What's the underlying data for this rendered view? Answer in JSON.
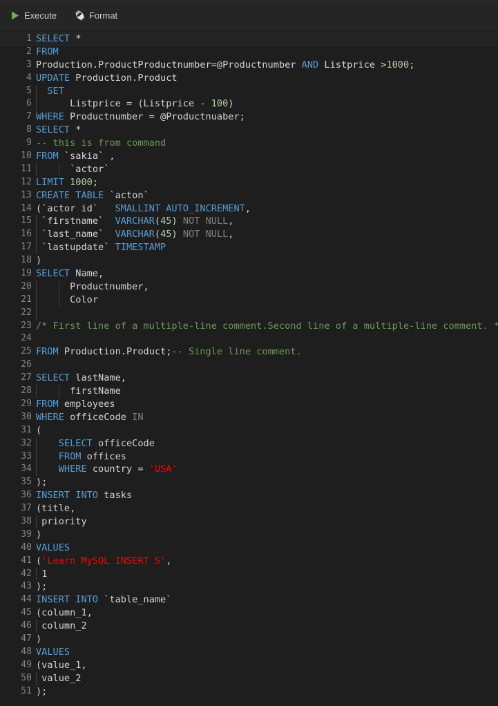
{
  "toolbar": {
    "execute": {
      "label": "Execute",
      "icon": "play-icon",
      "icon_color": "#6ab04c"
    },
    "format": {
      "label": "Format",
      "icon": "brush-icon"
    }
  },
  "editor": {
    "language": "sql",
    "theme": "dark",
    "active_line": 1,
    "total_lines": 51,
    "colors": {
      "background": "#1e1e1e",
      "gutter_text": "#858585",
      "keyword": "#569cd6",
      "plain": "#d4d4d4",
      "number": "#b5cea8",
      "string": "#ff0000",
      "comment": "#6a9955",
      "muted": "#808080",
      "indent_guide": "#404040",
      "active_line_bg": "#232323"
    },
    "lines": [
      {
        "n": "1",
        "active": true,
        "guides": [],
        "tokens": [
          {
            "t": "SELECT",
            "c": "kw"
          },
          {
            "t": " ",
            "c": "punc"
          },
          {
            "t": "*",
            "c": "txt"
          }
        ]
      },
      {
        "n": "2",
        "guides": [],
        "tokens": [
          {
            "t": "FROM",
            "c": "kw"
          }
        ]
      },
      {
        "n": "3",
        "guides": [],
        "tokens": [
          {
            "t": "Production.ProductProductnumber=@Productnumber ",
            "c": "txt"
          },
          {
            "t": "AND",
            "c": "kw"
          },
          {
            "t": " Listprice >",
            "c": "txt"
          },
          {
            "t": "1000",
            "c": "num"
          },
          {
            "t": ";",
            "c": "punc"
          }
        ]
      },
      {
        "n": "4",
        "guides": [],
        "tokens": [
          {
            "t": "UPDATE",
            "c": "kw"
          },
          {
            "t": " Production.Product",
            "c": "txt"
          }
        ]
      },
      {
        "n": "5",
        "guides": [
          0
        ],
        "tokens": [
          {
            "t": "  ",
            "c": "punc"
          },
          {
            "t": "SET",
            "c": "kw"
          }
        ]
      },
      {
        "n": "6",
        "guides": [
          0
        ],
        "tokens": [
          {
            "t": "      Listprice = (Listprice - ",
            "c": "txt"
          },
          {
            "t": "100",
            "c": "num"
          },
          {
            "t": ")",
            "c": "punc"
          }
        ]
      },
      {
        "n": "7",
        "guides": [],
        "tokens": [
          {
            "t": "WHERE",
            "c": "kw"
          },
          {
            "t": " Productnumber = @Productnuaber;",
            "c": "txt"
          }
        ]
      },
      {
        "n": "8",
        "guides": [],
        "tokens": [
          {
            "t": "SELECT",
            "c": "kw"
          },
          {
            "t": " ",
            "c": "punc"
          },
          {
            "t": "*",
            "c": "txt"
          }
        ]
      },
      {
        "n": "9",
        "guides": [],
        "tokens": [
          {
            "t": "-- this is from command",
            "c": "cmt"
          }
        ]
      },
      {
        "n": "10",
        "guides": [],
        "tokens": [
          {
            "t": "FROM",
            "c": "kw"
          },
          {
            "t": " `sakia` ,",
            "c": "txt"
          }
        ]
      },
      {
        "n": "11",
        "guides": [
          0,
          4
        ],
        "tokens": [
          {
            "t": "      `actor`",
            "c": "txt"
          }
        ]
      },
      {
        "n": "12",
        "guides": [],
        "tokens": [
          {
            "t": "LIMIT",
            "c": "kw"
          },
          {
            "t": " ",
            "c": "punc"
          },
          {
            "t": "1000",
            "c": "num"
          },
          {
            "t": ";",
            "c": "punc"
          }
        ]
      },
      {
        "n": "13",
        "guides": [],
        "tokens": [
          {
            "t": "CREATE TABLE",
            "c": "kw"
          },
          {
            "t": " `acton`",
            "c": "txt"
          }
        ]
      },
      {
        "n": "14",
        "guides": [],
        "tokens": [
          {
            "t": "(`actor id`   ",
            "c": "txt"
          },
          {
            "t": "SMALLINT AUTO_INCREMENT",
            "c": "kw"
          },
          {
            "t": ",",
            "c": "punc"
          }
        ]
      },
      {
        "n": "15",
        "guides": [
          0
        ],
        "tokens": [
          {
            "t": " `firstname`  ",
            "c": "txt"
          },
          {
            "t": "VARCHAR",
            "c": "kw"
          },
          {
            "t": "(",
            "c": "punc"
          },
          {
            "t": "45",
            "c": "num"
          },
          {
            "t": ") ",
            "c": "punc"
          },
          {
            "t": "NOT NULL",
            "c": "dim"
          },
          {
            "t": ",",
            "c": "punc"
          }
        ]
      },
      {
        "n": "16",
        "guides": [
          0
        ],
        "tokens": [
          {
            "t": " `last_name`  ",
            "c": "txt"
          },
          {
            "t": "VARCHAR",
            "c": "kw"
          },
          {
            "t": "(",
            "c": "punc"
          },
          {
            "t": "45",
            "c": "num"
          },
          {
            "t": ") ",
            "c": "punc"
          },
          {
            "t": "NOT NULL",
            "c": "dim"
          },
          {
            "t": ",",
            "c": "punc"
          }
        ]
      },
      {
        "n": "17",
        "guides": [
          0
        ],
        "tokens": [
          {
            "t": " `lastupdate` ",
            "c": "txt"
          },
          {
            "t": "TIMESTAMP",
            "c": "kw"
          }
        ]
      },
      {
        "n": "18",
        "guides": [],
        "tokens": [
          {
            "t": ")",
            "c": "punc"
          }
        ]
      },
      {
        "n": "19",
        "guides": [],
        "tokens": [
          {
            "t": "SELECT",
            "c": "kw"
          },
          {
            "t": " Name,",
            "c": "txt"
          }
        ]
      },
      {
        "n": "20",
        "guides": [
          0,
          4
        ],
        "tokens": [
          {
            "t": "      Productnumber,",
            "c": "txt"
          }
        ]
      },
      {
        "n": "21",
        "guides": [
          0,
          4
        ],
        "tokens": [
          {
            "t": "      Color",
            "c": "txt"
          }
        ]
      },
      {
        "n": "22",
        "guides": [
          0
        ],
        "tokens": [
          {
            "t": "",
            "c": "txt"
          }
        ]
      },
      {
        "n": "23",
        "guides": [],
        "tokens": [
          {
            "t": "/* First line of a multiple-line comment.Second line of a multiple-line comment. */",
            "c": "cmt"
          }
        ]
      },
      {
        "n": "24",
        "guides": [],
        "tokens": [
          {
            "t": "",
            "c": "txt"
          }
        ]
      },
      {
        "n": "25",
        "guides": [],
        "tokens": [
          {
            "t": "FROM",
            "c": "kw"
          },
          {
            "t": " Production.Product;",
            "c": "txt"
          },
          {
            "t": "-- Single line comment.",
            "c": "cmt"
          }
        ]
      },
      {
        "n": "26",
        "guides": [],
        "tokens": [
          {
            "t": "",
            "c": "txt"
          }
        ]
      },
      {
        "n": "27",
        "guides": [],
        "tokens": [
          {
            "t": "SELECT",
            "c": "kw"
          },
          {
            "t": " lastName,",
            "c": "txt"
          }
        ]
      },
      {
        "n": "28",
        "guides": [
          0,
          4
        ],
        "tokens": [
          {
            "t": "      firstName",
            "c": "txt"
          }
        ]
      },
      {
        "n": "29",
        "guides": [],
        "tokens": [
          {
            "t": "FROM",
            "c": "kw"
          },
          {
            "t": " employees",
            "c": "txt"
          }
        ]
      },
      {
        "n": "30",
        "guides": [],
        "tokens": [
          {
            "t": "WHERE",
            "c": "kw"
          },
          {
            "t": " officeCode ",
            "c": "txt"
          },
          {
            "t": "IN",
            "c": "dim"
          }
        ]
      },
      {
        "n": "31",
        "guides": [],
        "tokens": [
          {
            "t": "(",
            "c": "punc"
          }
        ]
      },
      {
        "n": "32",
        "guides": [
          0
        ],
        "tokens": [
          {
            "t": "    ",
            "c": "punc"
          },
          {
            "t": "SELECT",
            "c": "kw"
          },
          {
            "t": " officeCode",
            "c": "txt"
          }
        ]
      },
      {
        "n": "33",
        "guides": [
          0
        ],
        "tokens": [
          {
            "t": "    ",
            "c": "punc"
          },
          {
            "t": "FROM",
            "c": "kw"
          },
          {
            "t": " offices",
            "c": "txt"
          }
        ]
      },
      {
        "n": "34",
        "guides": [
          0
        ],
        "tokens": [
          {
            "t": "    ",
            "c": "punc"
          },
          {
            "t": "WHERE",
            "c": "kw"
          },
          {
            "t": " country = ",
            "c": "txt"
          },
          {
            "t": "'USA'",
            "c": "str"
          }
        ]
      },
      {
        "n": "35",
        "guides": [],
        "tokens": [
          {
            "t": ");",
            "c": "punc"
          }
        ]
      },
      {
        "n": "36",
        "guides": [],
        "tokens": [
          {
            "t": "INSERT INTO",
            "c": "kw"
          },
          {
            "t": " tasks",
            "c": "txt"
          }
        ]
      },
      {
        "n": "37",
        "guides": [],
        "tokens": [
          {
            "t": "(title,",
            "c": "txt"
          }
        ]
      },
      {
        "n": "38",
        "guides": [
          0
        ],
        "tokens": [
          {
            "t": " priority",
            "c": "txt"
          }
        ]
      },
      {
        "n": "39",
        "guides": [],
        "tokens": [
          {
            "t": ")",
            "c": "punc"
          }
        ]
      },
      {
        "n": "40",
        "guides": [],
        "tokens": [
          {
            "t": "VALUES",
            "c": "kw"
          }
        ]
      },
      {
        "n": "41",
        "guides": [],
        "tokens": [
          {
            "t": "(",
            "c": "punc"
          },
          {
            "t": "'Learn MySQL INSERT S'",
            "c": "str"
          },
          {
            "t": ",",
            "c": "punc"
          }
        ]
      },
      {
        "n": "42",
        "guides": [
          0
        ],
        "tokens": [
          {
            "t": " ",
            "c": "punc"
          },
          {
            "t": "1",
            "c": "num"
          }
        ]
      },
      {
        "n": "43",
        "guides": [],
        "tokens": [
          {
            "t": ");",
            "c": "punc"
          }
        ]
      },
      {
        "n": "44",
        "guides": [],
        "tokens": [
          {
            "t": "INSERT INTO",
            "c": "kw"
          },
          {
            "t": " `table_name`",
            "c": "txt"
          }
        ]
      },
      {
        "n": "45",
        "guides": [],
        "tokens": [
          {
            "t": "(column_1,",
            "c": "txt"
          }
        ]
      },
      {
        "n": "46",
        "guides": [
          0
        ],
        "tokens": [
          {
            "t": " column_2",
            "c": "txt"
          }
        ]
      },
      {
        "n": "47",
        "guides": [],
        "tokens": [
          {
            "t": ")",
            "c": "punc"
          }
        ]
      },
      {
        "n": "48",
        "guides": [],
        "tokens": [
          {
            "t": "VALUES",
            "c": "kw"
          }
        ]
      },
      {
        "n": "49",
        "guides": [],
        "tokens": [
          {
            "t": "(value_1,",
            "c": "txt"
          }
        ]
      },
      {
        "n": "50",
        "guides": [
          0
        ],
        "tokens": [
          {
            "t": " value_2",
            "c": "txt"
          }
        ]
      },
      {
        "n": "51",
        "guides": [],
        "tokens": [
          {
            "t": ");",
            "c": "punc"
          }
        ]
      }
    ]
  }
}
